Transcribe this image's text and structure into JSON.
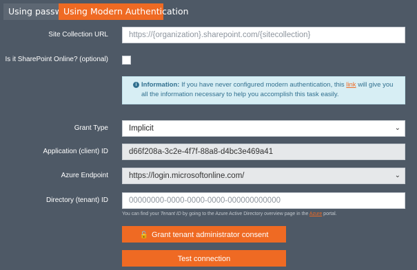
{
  "tabs": [
    {
      "label": "Using password",
      "active": false
    },
    {
      "label": "Using Modern Authentication",
      "active": true
    }
  ],
  "fields": {
    "site_collection_url": {
      "label": "Site Collection URL",
      "value": "",
      "placeholder": "https://{organization}.sharepoint.com/{sitecollection}"
    },
    "sharepoint_online": {
      "label": "Is it SharePoint Online? (optional)",
      "checked": false
    },
    "grant_type": {
      "label": "Grant Type",
      "value": "Implicit"
    },
    "client_id": {
      "label": "Application (client) ID",
      "value": "d66f208a-3c2e-4f7f-88a8-d4bc3e469a41"
    },
    "azure_endpoint": {
      "label": "Azure Endpoint",
      "value": "https://login.microsoftonline.com/"
    },
    "tenant_id": {
      "label": "Directory (tenant) ID",
      "value": "",
      "placeholder": "00000000-0000-0000-0000-000000000000"
    }
  },
  "info": {
    "title": "Information:",
    "text_before": "If you have never configured modern authentication, this",
    "link": "link",
    "text_after": "will give you all the information necessary to help you accomplish this task easily."
  },
  "help": {
    "before": "You can find your",
    "emphasis": "Tenant ID",
    "middle": "by going to the Azure Active Directory overview page in the",
    "link": "Azure",
    "after": "portal."
  },
  "buttons": {
    "grant_consent": "Grant tenant administrator consent",
    "test_connection": "Test connection"
  },
  "colors": {
    "accent": "#ef6a23",
    "background": "#4e5966",
    "info_bg": "#d7eef4"
  },
  "icons": {
    "info": "info-circle-icon",
    "lock": "unlock-icon",
    "chevron": "chevron-down-icon"
  }
}
